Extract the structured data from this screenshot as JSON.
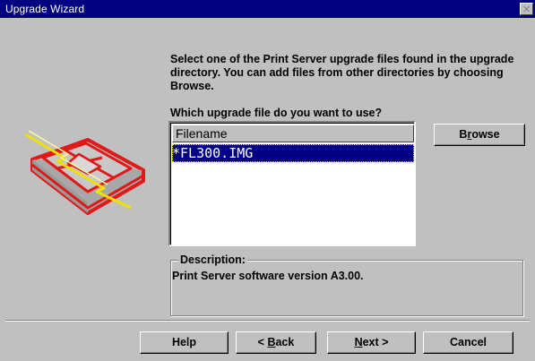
{
  "window": {
    "title": "Upgrade Wizard",
    "close_glyph": "×"
  },
  "instructions": "Select one of the Print Server upgrade files found in the upgrade directory. You can add files from other directories by choosing Browse.",
  "question": "Which upgrade file do you want to use?",
  "file_list": {
    "column_header": "Filename",
    "files": [
      {
        "name": "*FL300.IMG",
        "selected": true
      }
    ]
  },
  "browse_button": {
    "prefix": "B",
    "accel": "r",
    "rest": "owse"
  },
  "description": {
    "label": "Description:",
    "text": "Print Server software version A3.00."
  },
  "buttons": {
    "help": "Help",
    "back": {
      "prefix": "< ",
      "accel": "B",
      "rest": "ack"
    },
    "next": {
      "accel": "N",
      "rest": "ext >"
    },
    "cancel": "Cancel"
  },
  "colors": {
    "titlebar": "#000080",
    "face": "#c0c0c0",
    "selection": "#000080",
    "art_red": "#e01818",
    "art_yellow": "#f0e000"
  },
  "icons": {
    "wizard_art": "red-printer-with-lightning-icon",
    "close": "close-icon"
  }
}
